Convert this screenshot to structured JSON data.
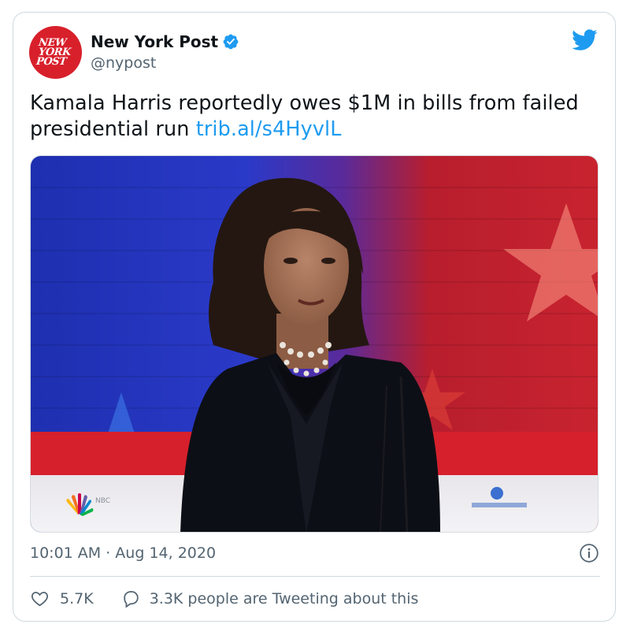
{
  "account": {
    "display_name": "New York Post",
    "handle": "@nypost",
    "avatar_text": [
      "NEW",
      "YORK",
      "POST"
    ],
    "verified": true
  },
  "tweet": {
    "text": "Kamala Harris reportedly owes $1M in bills from failed presidential run ",
    "link": "trib.al/s4HyvlL",
    "timestamp": "10:01 AM · Aug 14, 2020"
  },
  "photo": {
    "description_icon": "debate-stage-photo"
  },
  "actions": {
    "likes": "5.7K",
    "reply_text": "3.3K people are Tweeting about this"
  },
  "icons": {
    "brand": "twitter-bird-icon",
    "verified": "verified-badge-icon",
    "info": "info-icon",
    "like": "heart-icon",
    "reply": "reply-bubble-icon"
  },
  "colors": {
    "accent": "#1d9bf0",
    "avatar_bg": "#d8202b",
    "text": "#0f1419",
    "secondary_text": "#536471",
    "border": "#cfd9de"
  }
}
